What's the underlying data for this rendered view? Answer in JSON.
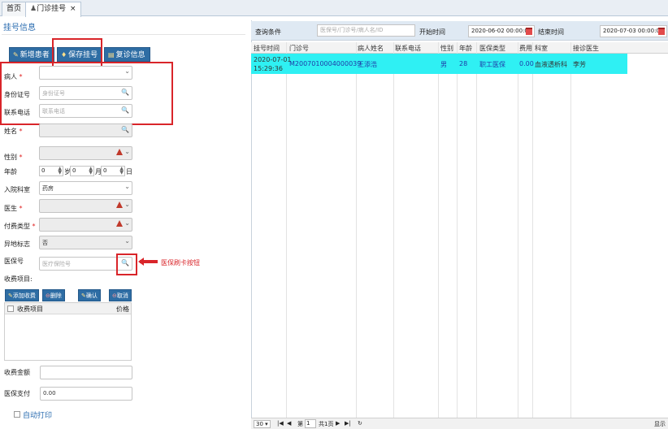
{
  "tabs": [
    {
      "label": "首页"
    },
    {
      "label": "门诊挂号"
    }
  ],
  "left": {
    "section_title": "挂号信息",
    "buttons": {
      "new_patient": "新增患者",
      "save": "保存挂号",
      "revisit": "复诊信息"
    },
    "fields": {
      "patient": {
        "label": "病人"
      },
      "id_card": {
        "label": "身份证号",
        "placeholder": "身份证号"
      },
      "phone": {
        "label": "联系电话",
        "placeholder": "联系电话"
      },
      "name": {
        "label": "姓名"
      },
      "gender": {
        "label": "性别"
      },
      "age": {
        "label": "年龄",
        "years": "0",
        "years_unit": "岁",
        "months": "0",
        "months_unit": "月",
        "days": "0",
        "days_unit": "日"
      },
      "dept": {
        "label": "入院科室",
        "value": "药房"
      },
      "doctor": {
        "label": "医生"
      },
      "pay_type": {
        "label": "付费类型"
      },
      "nonlocal": {
        "label": "异地标志",
        "value": "否"
      },
      "insurance": {
        "label": "医保号",
        "placeholder": "医疗保险号"
      }
    },
    "annotation": "医保刷卡按钮",
    "fee_section": {
      "label": "收费项目:",
      "buttons": {
        "add": "添加收费",
        "delete": "删除",
        "confirm": "确认",
        "cancel": "取消"
      },
      "col_item": "收费项目",
      "col_price": "价格"
    },
    "fee_amount": {
      "label": "收费金额",
      "value": ""
    },
    "insurance_pay": {
      "label": "医保支付",
      "value": "0.00"
    },
    "auto_print": "自动打印"
  },
  "query": {
    "label": "查询条件",
    "placeholder": "医保号/门诊号/病人名/ID",
    "start_label": "开始时间",
    "start_value": "2020-06-02 00:00:00",
    "end_label": "结束时间",
    "end_value": "2020-07-03 00:00:00"
  },
  "grid": {
    "columns": [
      "挂号时间",
      "门诊号",
      "病人姓名",
      "联系电话",
      "性别",
      "年龄",
      "医保类型",
      "费用",
      "科室",
      "接诊医生"
    ],
    "rows": [
      {
        "date": "2020-07-01",
        "time": "15:29:36",
        "outpatient_no": "M2007010004000039",
        "name": "王添浩",
        "phone": "",
        "gender": "男",
        "age": "28",
        "insurance_type": "职工医保",
        "fee": "0.00",
        "dept": "血液透析科",
        "doctor": "李芳"
      }
    ]
  },
  "pager": {
    "page_size": "30",
    "page_label": "第",
    "page_value": "1",
    "total": "共1页",
    "display": "显示"
  }
}
